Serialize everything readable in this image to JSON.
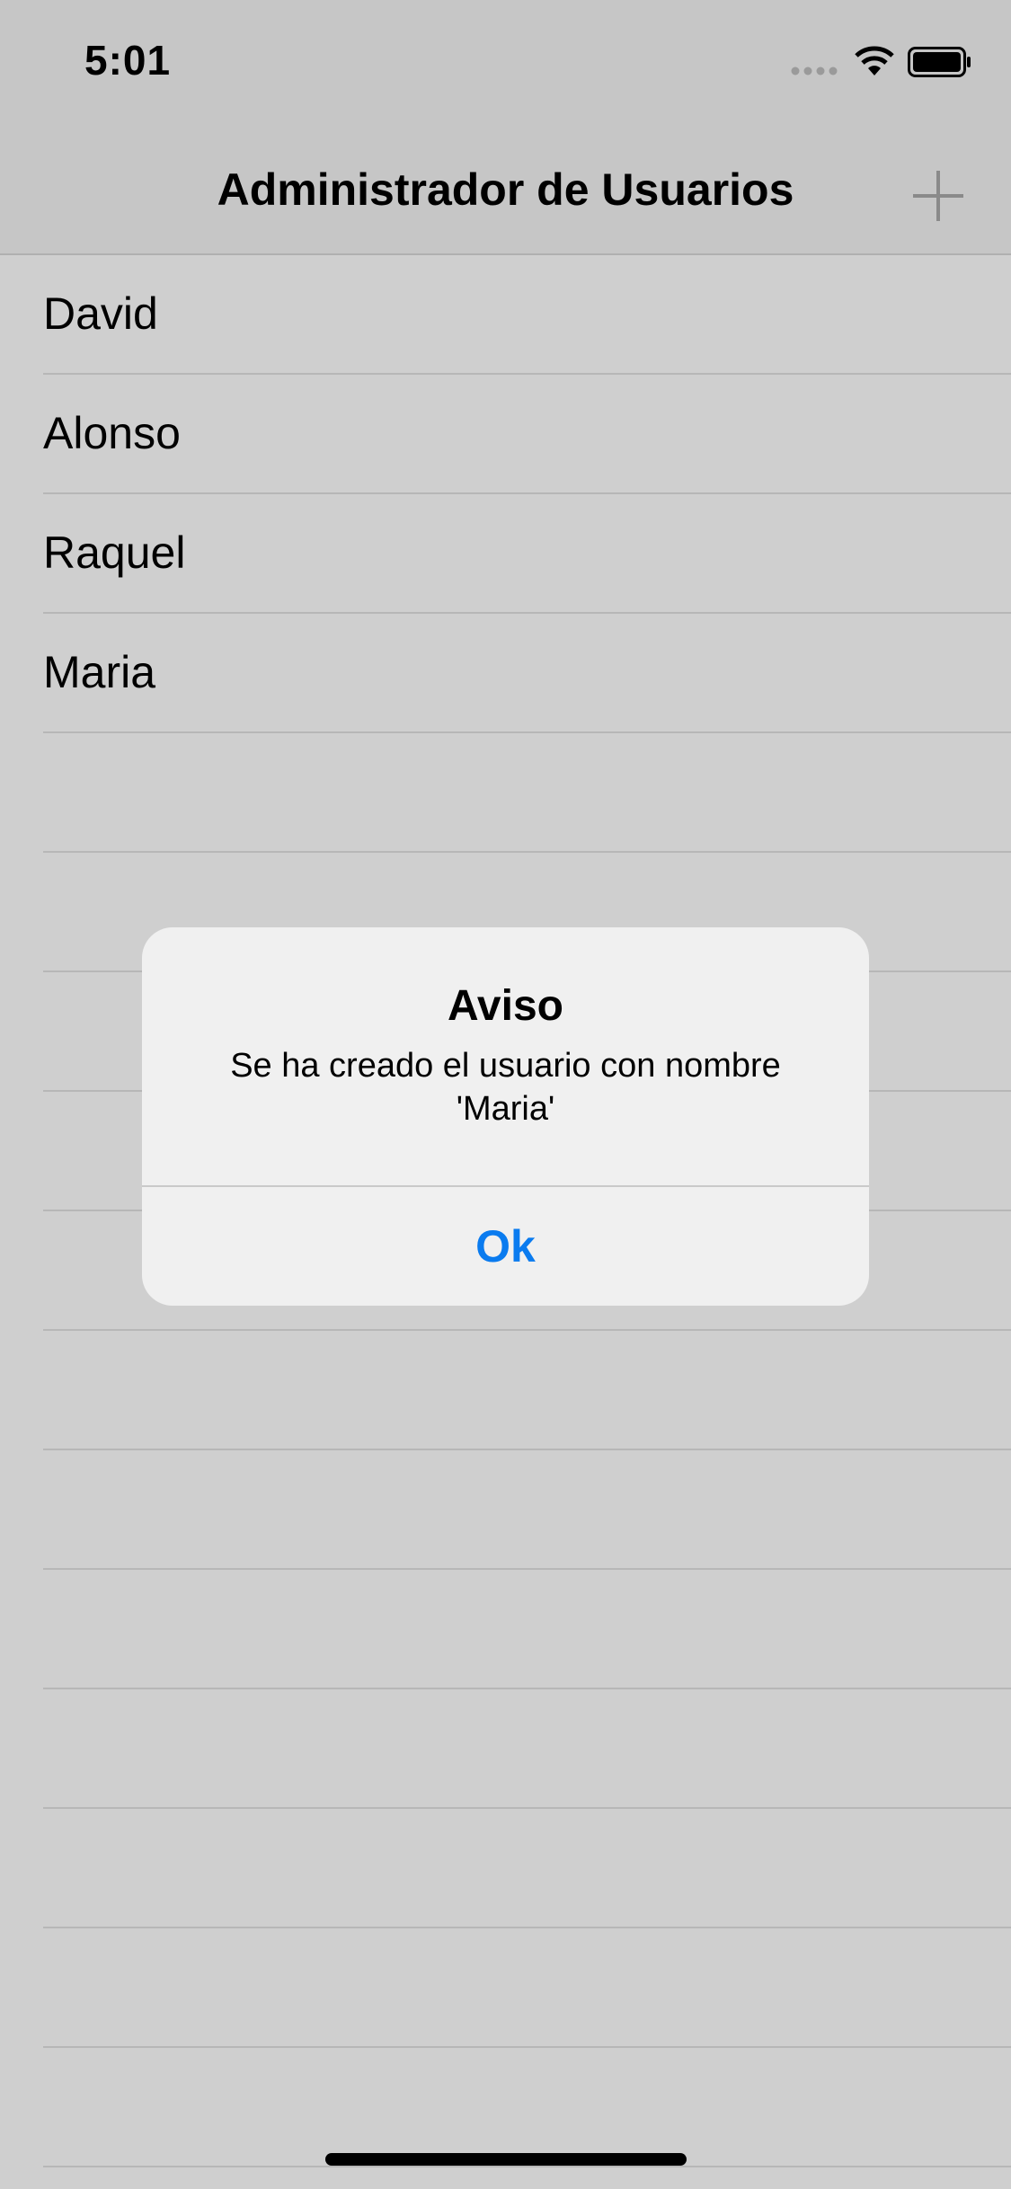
{
  "status_bar": {
    "time": "5:01"
  },
  "nav": {
    "title": "Administrador de Usuarios",
    "add_icon": "plus-icon"
  },
  "users": [
    {
      "name": "David"
    },
    {
      "name": "Alonso"
    },
    {
      "name": "Raquel"
    },
    {
      "name": "Maria"
    },
    {
      "name": ""
    },
    {
      "name": ""
    },
    {
      "name": ""
    },
    {
      "name": ""
    },
    {
      "name": ""
    },
    {
      "name": ""
    },
    {
      "name": ""
    },
    {
      "name": ""
    },
    {
      "name": ""
    },
    {
      "name": ""
    },
    {
      "name": ""
    },
    {
      "name": ""
    }
  ],
  "alert": {
    "title": "Aviso",
    "message": "Se ha creado el usuario con nombre 'Maria'",
    "ok_label": "Ok"
  },
  "colors": {
    "background": "#cfcfcf",
    "nav_background": "#c6c6c6",
    "alert_background": "#f0f0f0",
    "accent": "#0a7bef"
  }
}
